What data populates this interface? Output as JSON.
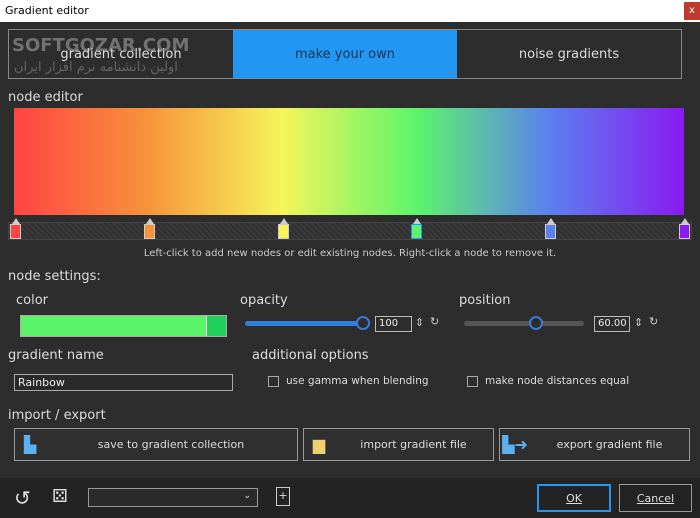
{
  "window": {
    "title": "Gradient editor",
    "close_label": "x"
  },
  "tabs": [
    {
      "label": "gradient collection",
      "active": false
    },
    {
      "label": "make your own",
      "active": true
    },
    {
      "label": "noise gradients",
      "active": false
    }
  ],
  "watermark": {
    "text": "SOFTGOZAR.COM",
    "subtext": "اولین دانشنامه نرم افزار ایران"
  },
  "node_editor": {
    "label": "node editor",
    "hint": "Left-click to add new nodes or edit existing nodes.  Right-click a node to remove it.",
    "nodes": [
      {
        "position": 0,
        "color": "#ff4444"
      },
      {
        "position": 20,
        "color": "#f7933a"
      },
      {
        "position": 40,
        "color": "#f5f55a"
      },
      {
        "position": 60,
        "color": "#5cf56a",
        "selected": true
      },
      {
        "position": 80,
        "color": "#5b80f0"
      },
      {
        "position": 100,
        "color": "#8a1af0"
      }
    ]
  },
  "node_settings": {
    "label": "node settings:",
    "color_label": "color",
    "color": "#5cf56a",
    "opacity_label": "opacity",
    "opacity": "100",
    "position_label": "position",
    "position": "60.00"
  },
  "gradient_name": {
    "label": "gradient name",
    "value": "Rainbow"
  },
  "additional_options": {
    "label": "additional options",
    "use_gamma": "use gamma when blending",
    "equal_distances": "make node distances equal"
  },
  "import_export": {
    "label": "import / export",
    "save": "save to gradient collection",
    "import": "import gradient file",
    "export": "export gradient file"
  },
  "footer": {
    "ok": "OK",
    "cancel": "Cancel"
  },
  "colors": {
    "accent": "#2196f3"
  }
}
